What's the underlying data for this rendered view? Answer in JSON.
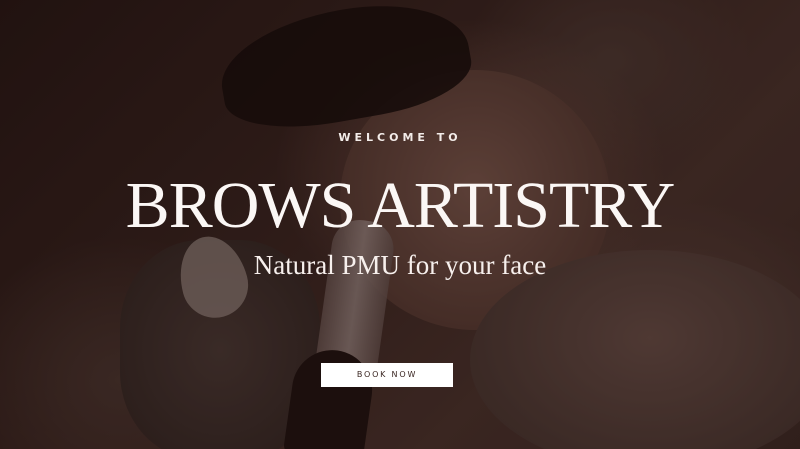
{
  "hero": {
    "eyebrow": "WELCOME TO",
    "title": "BROWS ARTISTRY",
    "subtitle": "Natural PMU for your face",
    "cta_label": "BOOK NOW"
  },
  "colors": {
    "overlay": "#2a1a16",
    "text": "#ffffff",
    "button_bg": "#ffffff",
    "button_text": "#3a2622"
  }
}
